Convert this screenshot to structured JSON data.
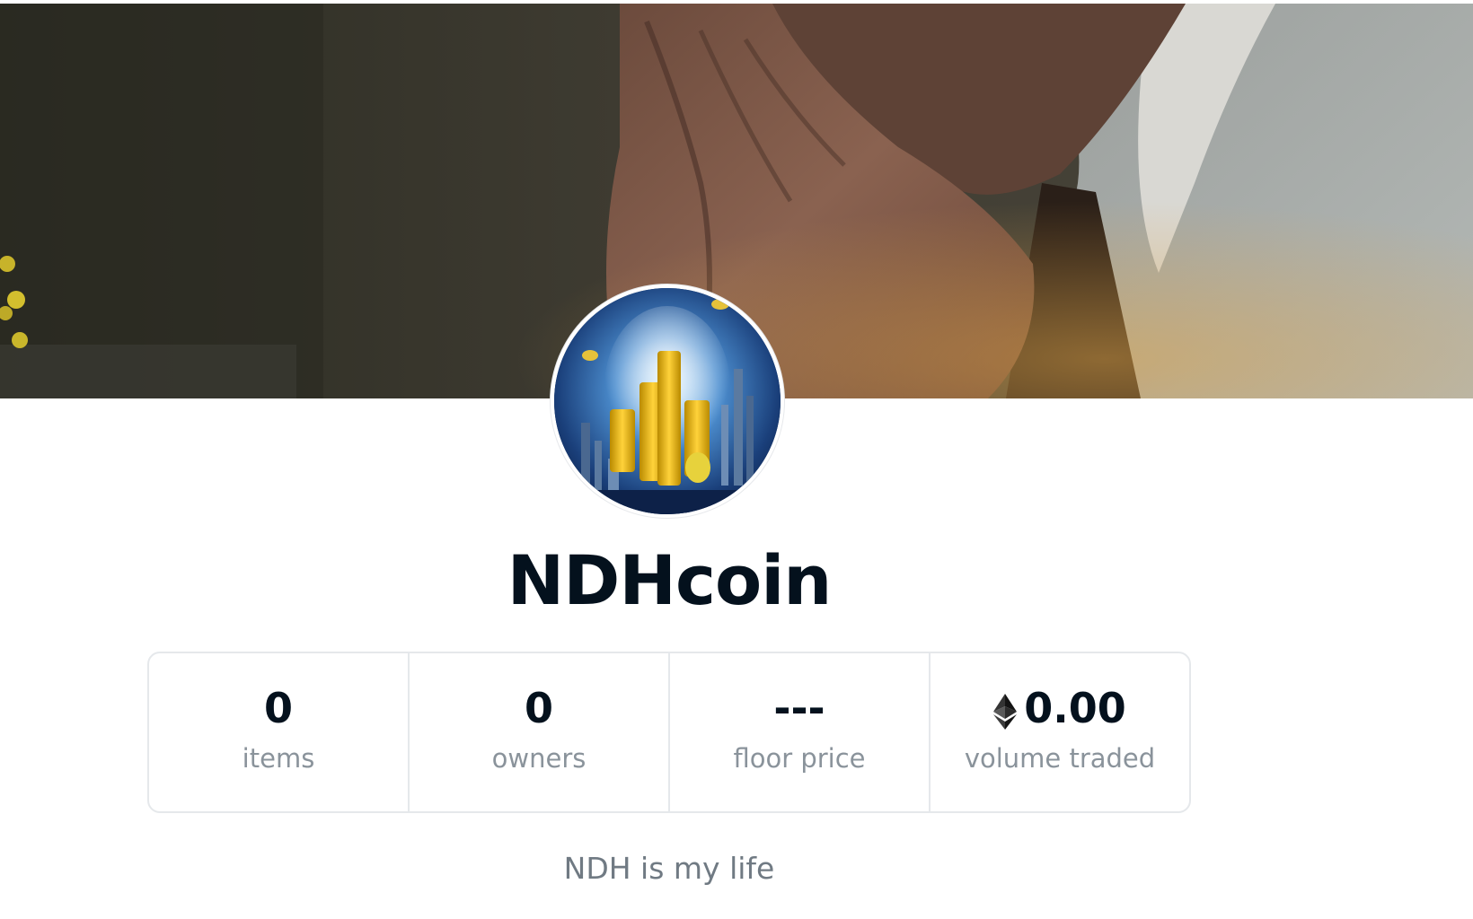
{
  "collection": {
    "name": "NDHcoin",
    "description": "NDH is my life"
  },
  "banner": {
    "alt": "banner-image"
  },
  "avatar": {
    "alt": "collection-avatar"
  },
  "stats": [
    {
      "value": "0",
      "label": "items"
    },
    {
      "value": "0",
      "label": "owners"
    },
    {
      "value": "---",
      "label": "floor price"
    },
    {
      "value": "0.00",
      "label": "volume traded",
      "icon": "eth-icon"
    }
  ],
  "colors": {
    "title": "#04111d",
    "label": "#8a939b",
    "border": "#e5e8eb",
    "description": "#707a83"
  }
}
